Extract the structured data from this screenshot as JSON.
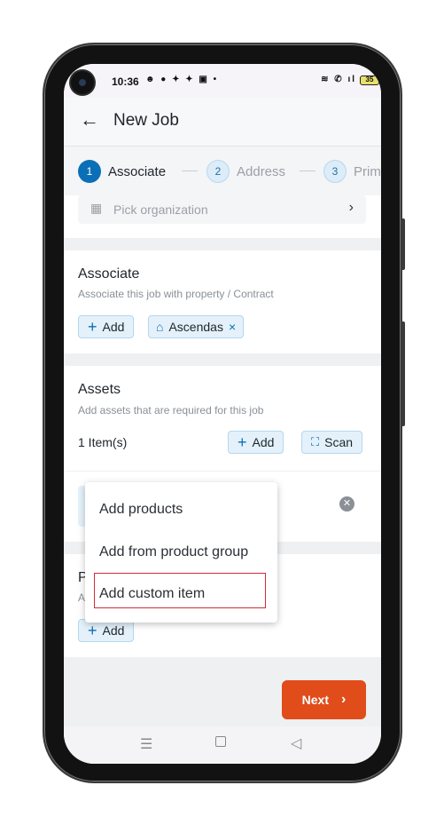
{
  "status_bar": {
    "time": "10:36",
    "left_icons": "☻ ● ✦ ✦ ▣ •",
    "right_icons": "≋ ✆ ıl",
    "battery": "35"
  },
  "header": {
    "title": "New Job"
  },
  "stepper": {
    "steps": [
      {
        "num": "1",
        "label": "Associate"
      },
      {
        "num": "2",
        "label": "Address"
      },
      {
        "num": "3",
        "label": "Prim"
      }
    ]
  },
  "organization": {
    "placeholder": "Pick organization"
  },
  "associate": {
    "title": "Associate",
    "subtitle": "Associate this job with property / Contract",
    "add_label": "Add",
    "tag_label": "Ascendas"
  },
  "assets": {
    "title": "Assets",
    "subtitle": "Add assets that are required for this job",
    "count": "1 Item(s)",
    "add_label": "Add",
    "scan_label": "Scan"
  },
  "section4": {
    "title_initial": "P",
    "subtitle_initial": "A",
    "add_label": "Add"
  },
  "menu": {
    "items": [
      "Add products",
      "Add from product group",
      "Add custom item"
    ]
  },
  "footer": {
    "next_label": "Next"
  },
  "colors": {
    "accent": "#0a6fb6",
    "next": "#e04c1a",
    "highlight": "#d22b3a"
  }
}
